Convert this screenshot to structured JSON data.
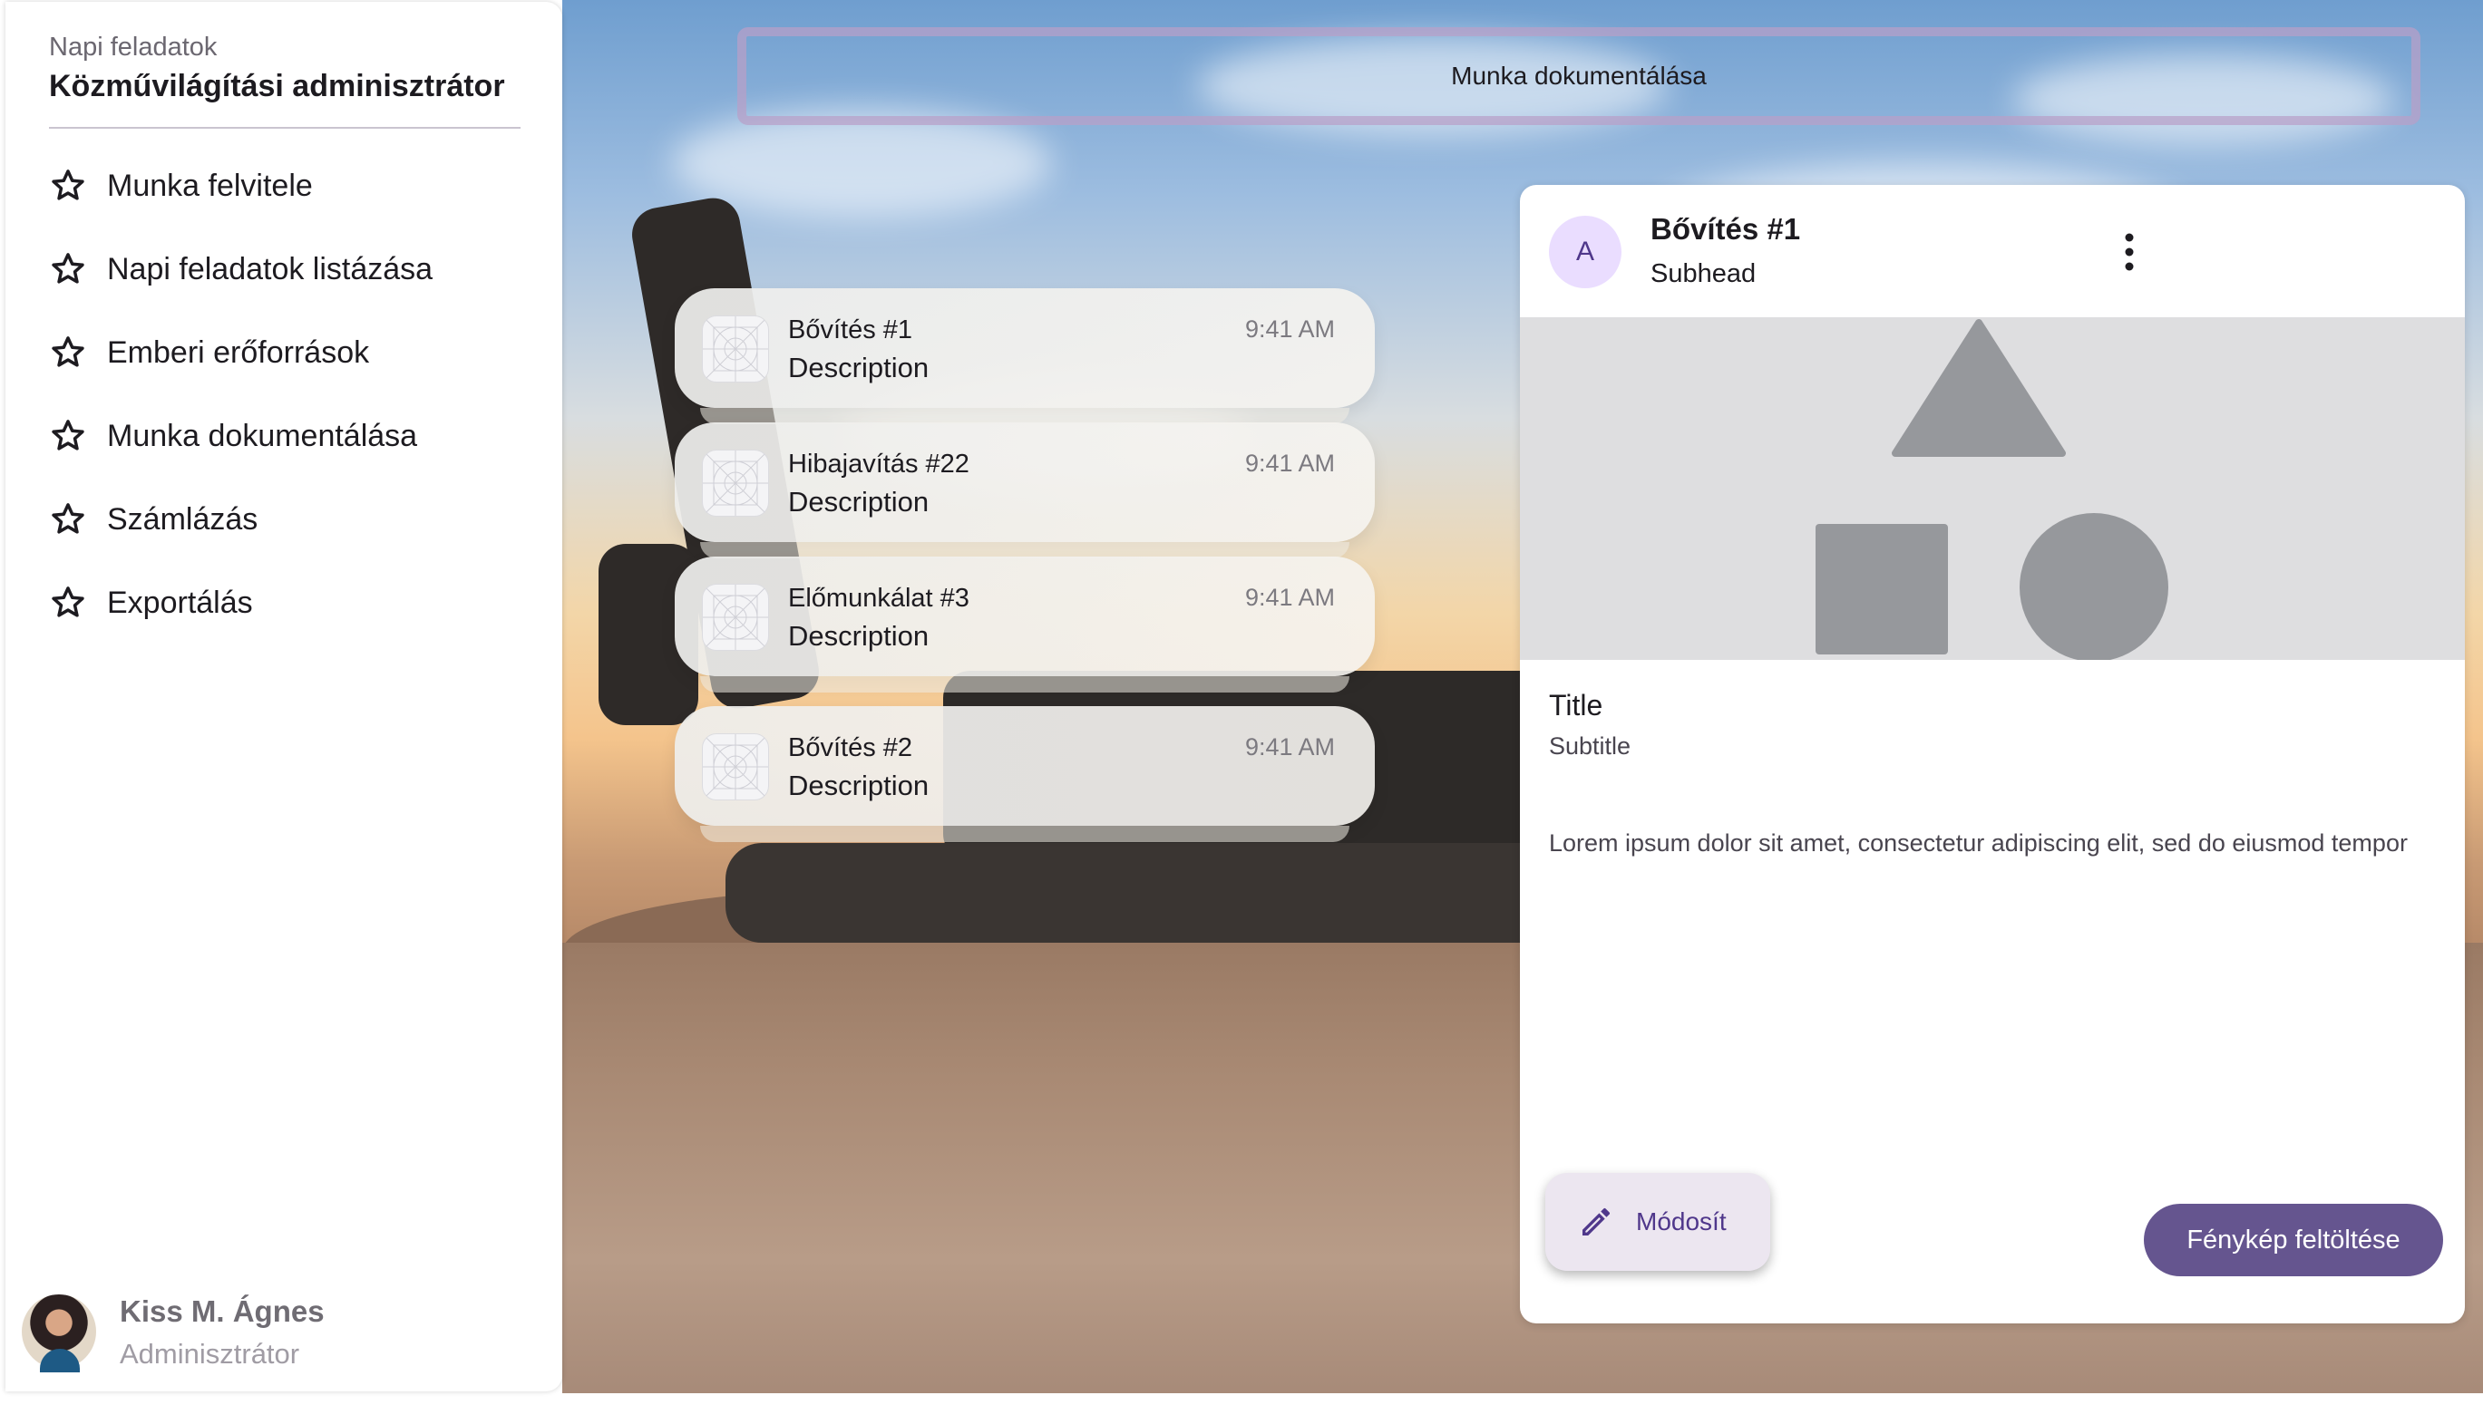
{
  "sidebar": {
    "section_label": "Napi feladatok",
    "title": "Közművilágítási adminisztrátor",
    "items": [
      {
        "label": "Munka felvitele",
        "icon": "star-icon"
      },
      {
        "label": "Napi feladatok listázása",
        "icon": "star-icon"
      },
      {
        "label": "Emberi erőforrások",
        "icon": "star-icon"
      },
      {
        "label": "Munka dokumentálása",
        "icon": "star-icon"
      },
      {
        "label": "Számlázás",
        "icon": "star-icon"
      },
      {
        "label": "Exportálás",
        "icon": "star-icon"
      }
    ],
    "user": {
      "name": "Kiss M. Ágnes",
      "role": "Adminisztrátor"
    }
  },
  "topbar": {
    "title": "Munka dokumentálása"
  },
  "notifications": [
    {
      "title": "Bővítés #1",
      "description": "Description",
      "time": "9:41 AM"
    },
    {
      "title": "Hibajavítás #22",
      "description": "Description",
      "time": "9:41 AM"
    },
    {
      "title": "Előmunkálat #3",
      "description": "Description",
      "time": "9:41 AM"
    },
    {
      "title": "Bővítés #2",
      "description": "Description",
      "time": "9:41 AM"
    }
  ],
  "card": {
    "avatar_letter": "A",
    "header_title": "Bővítés #1",
    "header_subhead": "Subhead",
    "title": "Title",
    "subtitle": "Subtitle",
    "body": "Lorem ipsum dolor sit amet, consectetur adipiscing elit, sed do eiusmod tempor",
    "edit_label": "Módosít",
    "upload_label": "Fénykép feltöltése"
  },
  "colors": {
    "primary": "#65558f",
    "primary_container": "#eaddff",
    "on_primary_container": "#4f378b",
    "surface_container": "#ece6f0",
    "topbar_border": "#b8a0c8"
  }
}
